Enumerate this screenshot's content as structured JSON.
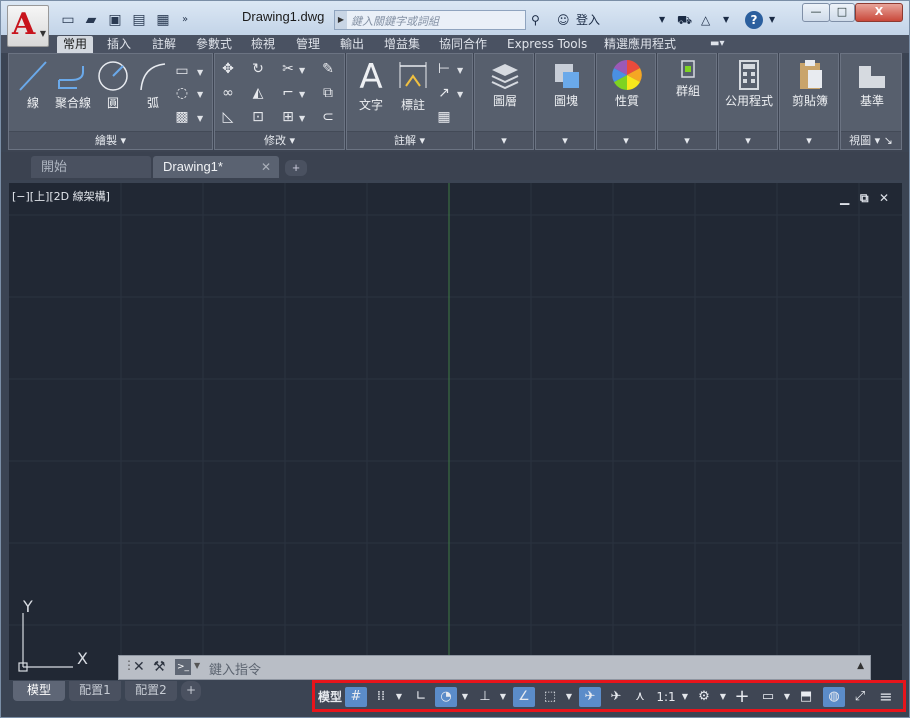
{
  "window": {
    "doc_title": "Drawing1.dwg",
    "search_placeholder": "鍵入關鍵字或詞組",
    "login_label": "登入",
    "minimize": "—",
    "maximize": "□",
    "close": "X"
  },
  "ribbon_tabs": [
    "常用",
    "插入",
    "註解",
    "參數式",
    "檢視",
    "管理",
    "輸出",
    "增益集",
    "協同合作",
    "Express Tools",
    "精選應用程式"
  ],
  "panels": {
    "draw": {
      "title": "繪製",
      "tools": [
        "線",
        "聚合線",
        "圓",
        "弧"
      ]
    },
    "modify": {
      "title": "修改"
    },
    "annotate": {
      "title": "註解",
      "tools": [
        "文字",
        "標註"
      ]
    },
    "layers": "圖層",
    "block": "圖塊",
    "properties": "性質",
    "groups": "群組",
    "utilities": "公用程式",
    "clipboard": "剪貼簿",
    "view": {
      "label": "基準",
      "title": "視圖"
    }
  },
  "doc_tabs": {
    "start": "開始",
    "current": "Drawing1*",
    "close": "✕",
    "new": "+"
  },
  "viewport": {
    "label": "[−][上][2D 線架構]",
    "axis_y": "Y",
    "axis_x": "X"
  },
  "command_line": {
    "placeholder": "鍵入指令"
  },
  "layout_tabs": [
    "模型",
    "配置1",
    "配置2"
  ],
  "layout_add": "+",
  "status_bar": {
    "model": "模型",
    "scale": "1:1"
  },
  "colors": {
    "accent": "#5b8cc9",
    "highlight_border": "#e8141b",
    "canvas": "#212834"
  }
}
